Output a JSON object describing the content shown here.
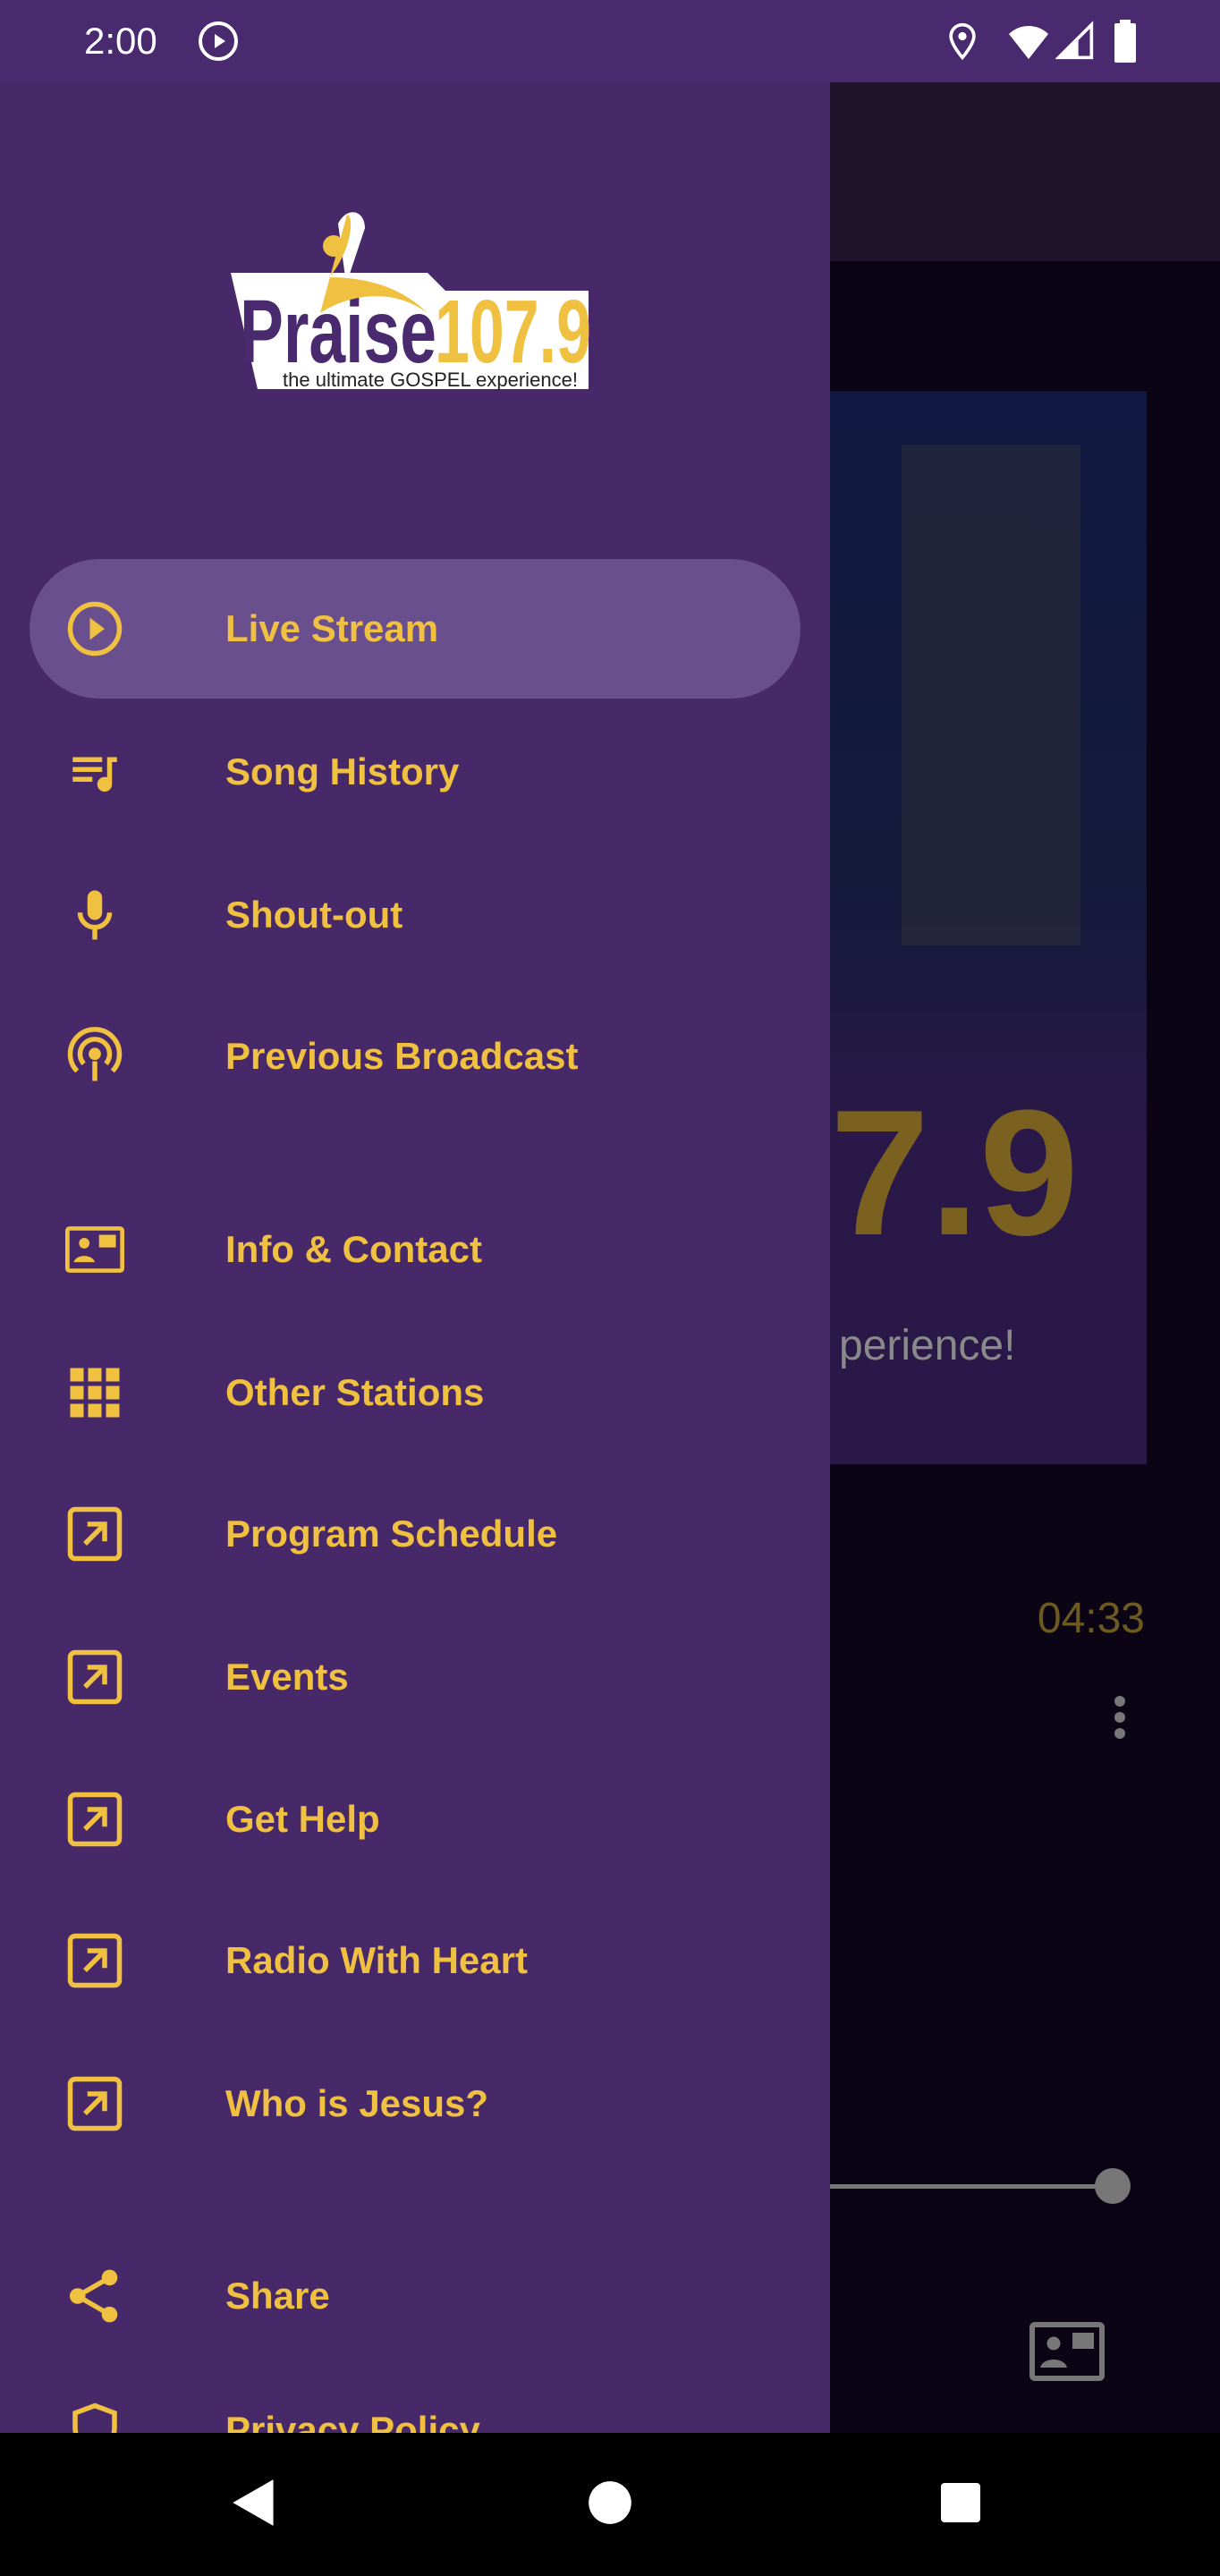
{
  "status_bar": {
    "time": "2:00",
    "icons": [
      "play-circle-icon",
      "location-icon",
      "wifi-icon",
      "signal-icon",
      "battery-icon"
    ]
  },
  "background": {
    "timer": "04:33",
    "progress": 1.0
  },
  "drawer": {
    "logo_text": "Praise107.9 the ultimate GOSPEL experience!",
    "items": [
      {
        "label": "Live Stream",
        "icon": "play-circle-icon",
        "active": true
      },
      {
        "label": "Song History",
        "icon": "playlist-icon"
      },
      {
        "label": "Shout-out",
        "icon": "microphone-icon"
      },
      {
        "label": "Previous Broadcast",
        "icon": "podcast-icon"
      },
      {
        "label": "Info & Contact",
        "icon": "contact-card-icon"
      },
      {
        "label": "Other Stations",
        "icon": "grid-icon"
      },
      {
        "label": "Program Schedule",
        "icon": "external-link-icon"
      },
      {
        "label": "Events",
        "icon": "external-link-icon"
      },
      {
        "label": "Get Help",
        "icon": "external-link-icon"
      },
      {
        "label": "Radio With Heart",
        "icon": "external-link-icon"
      },
      {
        "label": "Who is Jesus?",
        "icon": "external-link-icon"
      },
      {
        "label": "Share",
        "icon": "share-icon"
      },
      {
        "label": "Privacy Policy",
        "icon": "shield-icon"
      }
    ]
  },
  "colors": {
    "drawer_bg": "#472869",
    "accent": "#f0c040",
    "active_bg": "#6a4f8f"
  }
}
